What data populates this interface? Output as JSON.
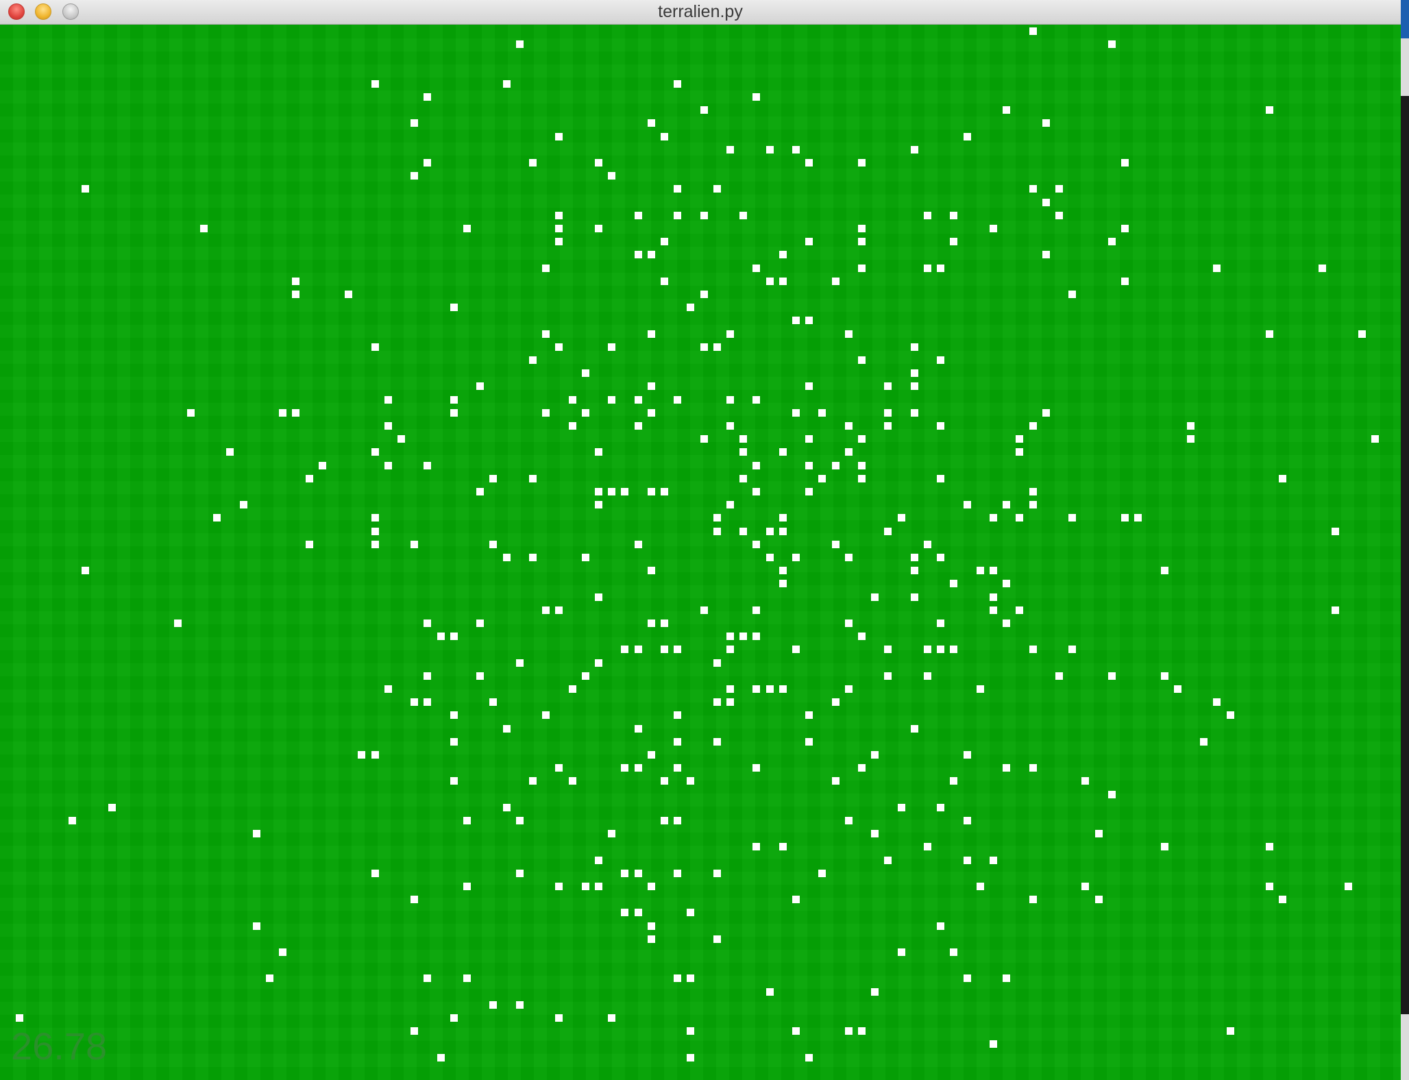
{
  "window": {
    "title": "terralien.py"
  },
  "hud": {
    "fps": "26.78"
  },
  "colors": {
    "ground": "#05a505",
    "entity": "#ffffff",
    "fps_text": "#2f8f2f"
  },
  "entities_count_hint": 400
}
